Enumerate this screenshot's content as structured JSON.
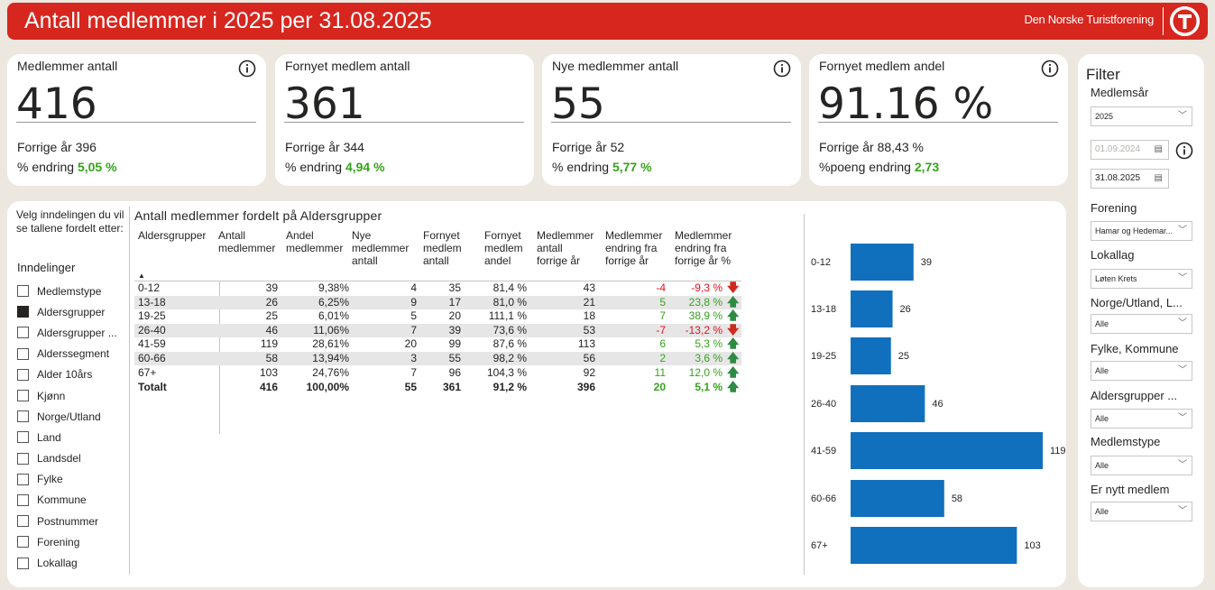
{
  "header": {
    "title": "Antall medlemmer i 2025 per 31.08.2025",
    "org": "Den Norske Turistforening",
    "brand_color": "#d7261e"
  },
  "kpis": [
    {
      "label": "Medlemmer antall",
      "value": "416",
      "prev": "Forrige år 396",
      "chg_label": "% endring",
      "chg_value": "5,05 %"
    },
    {
      "label": "Fornyet medlem antall",
      "value": "361",
      "prev": "Forrige år 344",
      "chg_label": "% endring",
      "chg_value": "4,94 %"
    },
    {
      "label": "Nye medlemmer antall",
      "value": "55",
      "prev": "Forrige år 52",
      "chg_label": "% endring",
      "chg_value": "5,77 %"
    },
    {
      "label": "Fornyet medlem andel",
      "value": "91.16 %",
      "prev": "Forrige år 88,43 %",
      "chg_label": "%poeng endring",
      "chg_value": "2,73"
    }
  ],
  "inndelinger": {
    "instructions": "Velg inndelingen du vil se tallene fordelt etter:",
    "title": "Inndelinger",
    "items": [
      {
        "label": "Medlemstype",
        "checked": false
      },
      {
        "label": "Aldersgrupper",
        "checked": true
      },
      {
        "label": "Aldersgrupper ...",
        "checked": false
      },
      {
        "label": "Alderssegment",
        "checked": false
      },
      {
        "label": "Alder 10års",
        "checked": false
      },
      {
        "label": "Kjønn",
        "checked": false
      },
      {
        "label": "Norge/Utland",
        "checked": false
      },
      {
        "label": "Land",
        "checked": false
      },
      {
        "label": "Landsdel",
        "checked": false
      },
      {
        "label": "Fylke",
        "checked": false
      },
      {
        "label": "Kommune",
        "checked": false
      },
      {
        "label": "Postnummer",
        "checked": false
      },
      {
        "label": "Forening",
        "checked": false
      },
      {
        "label": "Lokallag",
        "checked": false
      }
    ]
  },
  "table": {
    "title": "Antall medlemmer fordelt på Aldersgrupper",
    "headers": [
      "Aldersgrupper",
      "Antall\nmedlemmer",
      "Andel\nmedlemmer",
      "Nye\nmedlemmer\nantall",
      "Fornyet\nmedlem\nantall",
      "Fornyet\nmedlem\nandel",
      "Medlemmer\nantall\nforrige år",
      "Medlemmer\nendring fra\nforrige år",
      "Medlemmer\nendring fra\nforrige år %"
    ],
    "rows": [
      [
        "0-12",
        "39",
        "9,38%",
        "4",
        "35",
        "81,4 %",
        "43",
        "-4",
        "-9,3 %",
        "down"
      ],
      [
        "13-18",
        "26",
        "6,25%",
        "9",
        "17",
        "81,0 %",
        "21",
        "5",
        "23,8 %",
        "up"
      ],
      [
        "19-25",
        "25",
        "6,01%",
        "5",
        "20",
        "111,1 %",
        "18",
        "7",
        "38,9 %",
        "up"
      ],
      [
        "26-40",
        "46",
        "11,06%",
        "7",
        "39",
        "73,6 %",
        "53",
        "-7",
        "-13,2 %",
        "down"
      ],
      [
        "41-59",
        "119",
        "28,61%",
        "20",
        "99",
        "87,6 %",
        "113",
        "6",
        "5,3 %",
        "up"
      ],
      [
        "60-66",
        "58",
        "13,94%",
        "3",
        "55",
        "98,2 %",
        "56",
        "2",
        "3,6 %",
        "up"
      ],
      [
        "67+",
        "103",
        "24,76%",
        "7",
        "96",
        "104,3 %",
        "92",
        "11",
        "12,0 %",
        "up"
      ]
    ],
    "total": [
      "Totalt",
      "416",
      "100,00%",
      "55",
      "361",
      "91,2 %",
      "396",
      "20",
      "5,1 %",
      "up"
    ]
  },
  "chart_data": {
    "type": "bar",
    "orientation": "horizontal",
    "categories": [
      "0-12",
      "13-18",
      "19-25",
      "26-40",
      "41-59",
      "60-66",
      "67+"
    ],
    "values": [
      39,
      26,
      25,
      46,
      119,
      58,
      103
    ],
    "color": "#1170bd"
  },
  "filter": {
    "title": "Filter",
    "medlemsar_label": "Medlemsår",
    "medlemsar_value": "2025",
    "date_from": "01.09.2024",
    "date_to": "31.08.2025",
    "forening_label": "Forening",
    "forening_value": "Hamar og Hedemar...",
    "lokallag_label": "Lokallag",
    "lokallag_value": "Løten Krets",
    "norge_label": "Norge/Utland, L...",
    "norge_value": "Alle",
    "fylke_label": "Fylke, Kommune",
    "fylke_value": "Alle",
    "alders_label": "Aldersgrupper ...",
    "alders_value": "Alle",
    "medlemstype_label": "Medlemstype",
    "medlemstype_value": "Alle",
    "nytt_label": "Er nytt medlem",
    "nytt_value": "Alle"
  }
}
